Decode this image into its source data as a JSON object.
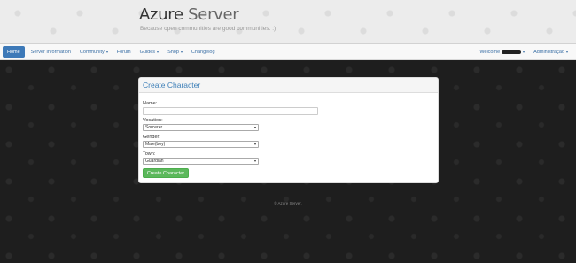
{
  "header": {
    "brand_main": "Azure",
    "brand_light": " Server",
    "tagline": "Because open communities are good communities. :)"
  },
  "nav": {
    "items": [
      {
        "label": "Home"
      },
      {
        "label": "Server Information"
      },
      {
        "label": "Community"
      },
      {
        "label": "Forum"
      },
      {
        "label": "Guides"
      },
      {
        "label": "Shop"
      },
      {
        "label": "Changelog"
      }
    ],
    "welcome_label": "Welcome",
    "admin_label": "Administração"
  },
  "form": {
    "title": "Create Character",
    "name_label": "Name:",
    "name_value": "",
    "vocation_label": "Vocation:",
    "vocation_value": "Sorcerer",
    "gender_label": "Gender:",
    "gender_value": "Male(boy)",
    "town_label": "Town:",
    "town_value": "Guardian",
    "submit_label": "Create Character"
  },
  "footer": {
    "text": "© Azure Server."
  },
  "colors": {
    "accent": "#3d79b8",
    "success": "#5cb85c",
    "background": "#1e1e1e"
  }
}
